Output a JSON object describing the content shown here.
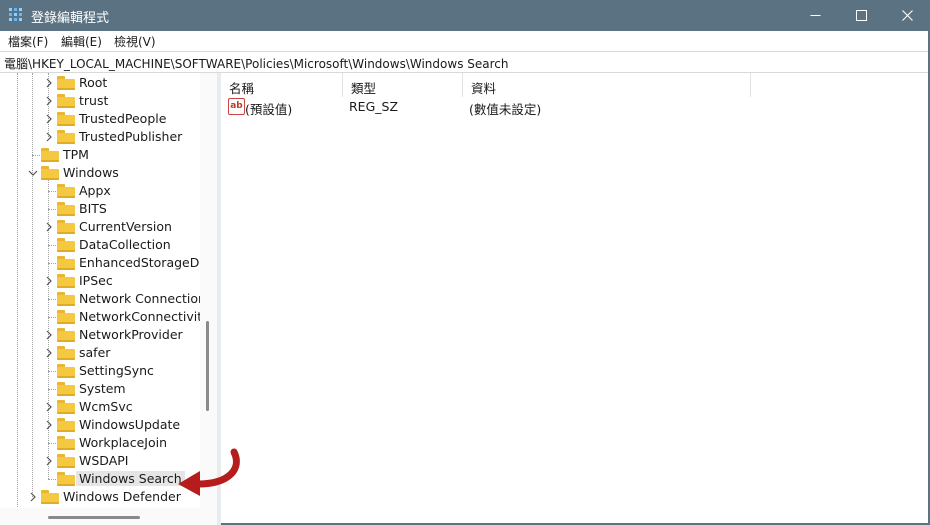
{
  "window": {
    "title": "登錄編輯程式",
    "icons": {
      "app": "registry-editor-icon",
      "minimize": "minimize-icon",
      "maximize": "maximize-icon",
      "close": "close-icon"
    }
  },
  "menu": {
    "items": [
      "檔案(F)",
      "編輯(E)",
      "檢視(V)"
    ]
  },
  "address": {
    "path": "電腦\\HKEY_LOCAL_MACHINE\\SOFTWARE\\Policies\\Microsoft\\Windows\\Windows Search"
  },
  "tree": {
    "items": [
      {
        "label": "Root",
        "expander": "collapsed"
      },
      {
        "label": "trust",
        "expander": "collapsed"
      },
      {
        "label": "TrustedPeople",
        "expander": "collapsed"
      },
      {
        "label": "TrustedPublisher",
        "expander": "collapsed"
      },
      {
        "label": "TPM",
        "expander": "none"
      },
      {
        "label": "Windows",
        "expander": "expanded"
      },
      {
        "label": "Appx",
        "expander": "none"
      },
      {
        "label": "BITS",
        "expander": "none"
      },
      {
        "label": "CurrentVersion",
        "expander": "collapsed"
      },
      {
        "label": "DataCollection",
        "expander": "none"
      },
      {
        "label": "EnhancedStorageDev",
        "expander": "none"
      },
      {
        "label": "IPSec",
        "expander": "collapsed"
      },
      {
        "label": "Network Connections",
        "expander": "none"
      },
      {
        "label": "NetworkConnectivityS",
        "expander": "none"
      },
      {
        "label": "NetworkProvider",
        "expander": "collapsed"
      },
      {
        "label": "safer",
        "expander": "collapsed"
      },
      {
        "label": "SettingSync",
        "expander": "none"
      },
      {
        "label": "System",
        "expander": "none"
      },
      {
        "label": "WcmSvc",
        "expander": "collapsed"
      },
      {
        "label": "WindowsUpdate",
        "expander": "collapsed"
      },
      {
        "label": "WorkplaceJoin",
        "expander": "none"
      },
      {
        "label": "WSDAPI",
        "expander": "collapsed"
      },
      {
        "label": "Windows Search",
        "expander": "none",
        "selected": true
      },
      {
        "label": "Windows Defender",
        "expander": "collapsed"
      }
    ]
  },
  "list": {
    "columns": [
      "名稱",
      "類型",
      "資料"
    ],
    "rows": [
      {
        "name": "(預設值)",
        "type": "REG_SZ",
        "data": "(數值未設定)",
        "icon": "string-value-icon"
      }
    ]
  },
  "annotation": {
    "icon": "red-curved-arrow-icon",
    "color": "#b71c1c"
  },
  "colors": {
    "titlebar": "#5b7282",
    "folder": "#f5c842",
    "selection": "#e5e5e5"
  }
}
